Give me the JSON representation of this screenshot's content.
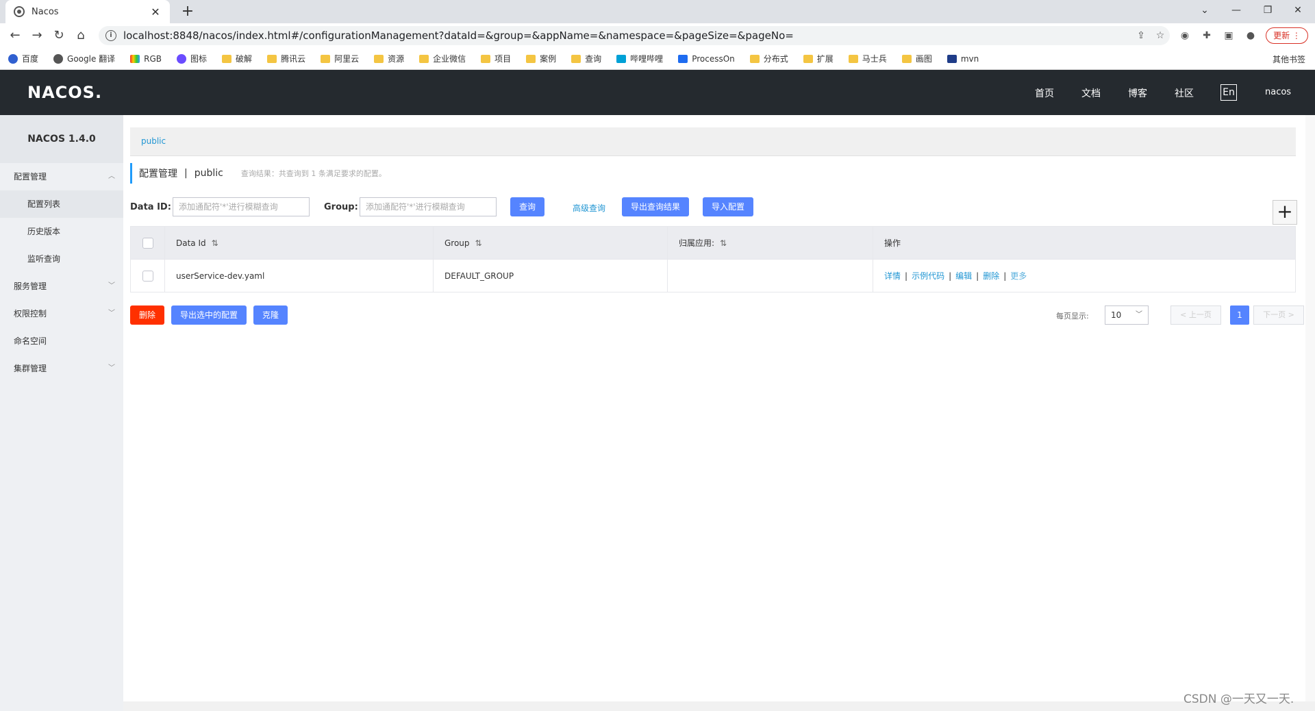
{
  "browser": {
    "tab_title": "Nacos",
    "url": "localhost:8848/nacos/index.html#/configurationManagement?dataId=&group=&appName=&namespace=&pageSize=&pageNo=",
    "update_label": "更新",
    "bookmarks": [
      "百度",
      "Google 翻译",
      "RGB",
      "图标",
      "破解",
      "腾讯云",
      "阿里云",
      "资源",
      "企业微信",
      "项目",
      "案例",
      "查询",
      "哔哩哔哩",
      "ProcessOn",
      "分布式",
      "扩展",
      "马士兵",
      "画图",
      "mvn"
    ],
    "other_bookmarks": "其他书签"
  },
  "header": {
    "logo": "NACOS.",
    "nav": [
      "首页",
      "文档",
      "博客",
      "社区"
    ],
    "lang": "En",
    "user": "nacos"
  },
  "sidebar": {
    "version": "NACOS 1.4.0",
    "config_mgmt": "配置管理",
    "config_list": "配置列表",
    "history": "历史版本",
    "listener_query": "监听查询",
    "service_mgmt": "服务管理",
    "access_control": "权限控制",
    "namespace": "命名空间",
    "cluster_mgmt": "集群管理"
  },
  "main": {
    "namespace_tab": "public",
    "title": "配置管理",
    "title_sep": "|",
    "title_ns": "public",
    "result_hint": "查询结果：共查询到 1 条满足要求的配置。",
    "filter": {
      "dataid_label": "Data ID:",
      "dataid_placeholder": "添加通配符'*'进行模糊查询",
      "group_label": "Group:",
      "group_placeholder": "添加通配符'*'进行模糊查询",
      "query_btn": "查询",
      "advanced_link": "高级查询",
      "export_btn": "导出查询结果",
      "import_btn": "导入配置",
      "plus": "+"
    },
    "table": {
      "headers": [
        "Data Id",
        "Group",
        "归属应用:",
        "操作"
      ],
      "sort_glyph": "⇅",
      "rows": [
        {
          "data_id": "userService-dev.yaml",
          "group": "DEFAULT_GROUP",
          "app": ""
        }
      ],
      "ops": [
        "详情",
        "示例代码",
        "编辑",
        "删除",
        "更多"
      ],
      "op_sep": "|"
    },
    "bottom": {
      "delete_btn": "删除",
      "export_selected_btn": "导出选中的配置",
      "clone_btn": "克隆",
      "page_size_label": "每页显示:",
      "page_size": "10",
      "prev": "< 上一页",
      "current_page": "1",
      "next": "下一页 >"
    }
  },
  "watermark": "CSDN @一天又一天."
}
